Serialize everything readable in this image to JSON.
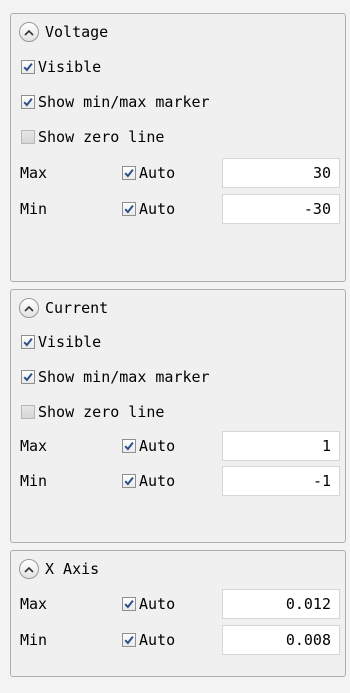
{
  "panels": [
    {
      "title": "Voltage",
      "visible_label": "Visible",
      "visible_checked": true,
      "minmax_label": "Show min/max marker",
      "minmax_checked": true,
      "zero_label": "Show zero line",
      "zero_checked": false,
      "max": {
        "label": "Max",
        "auto_label": "Auto",
        "auto_checked": true,
        "value": "30"
      },
      "min": {
        "label": "Min",
        "auto_label": "Auto",
        "auto_checked": true,
        "value": "-30"
      }
    },
    {
      "title": "Current",
      "visible_label": "Visible",
      "visible_checked": true,
      "minmax_label": "Show min/max marker",
      "minmax_checked": true,
      "zero_label": "Show zero line",
      "zero_checked": false,
      "max": {
        "label": "Max",
        "auto_label": "Auto",
        "auto_checked": true,
        "value": "1"
      },
      "min": {
        "label": "Min",
        "auto_label": "Auto",
        "auto_checked": true,
        "value": "-1"
      }
    },
    {
      "title": "X Axis",
      "max": {
        "label": "Max",
        "auto_label": "Auto",
        "auto_checked": true,
        "value": "0.012"
      },
      "min": {
        "label": "Min",
        "auto_label": "Auto",
        "auto_checked": true,
        "value": "0.008"
      }
    }
  ],
  "icons": {
    "collapse": "chevron-up-icon",
    "checkbox_checked": "checkmark-icon"
  },
  "colors": {
    "checkmark": "#2c4f8c",
    "group_border": "#adadad",
    "background": "#f0f0f0"
  }
}
